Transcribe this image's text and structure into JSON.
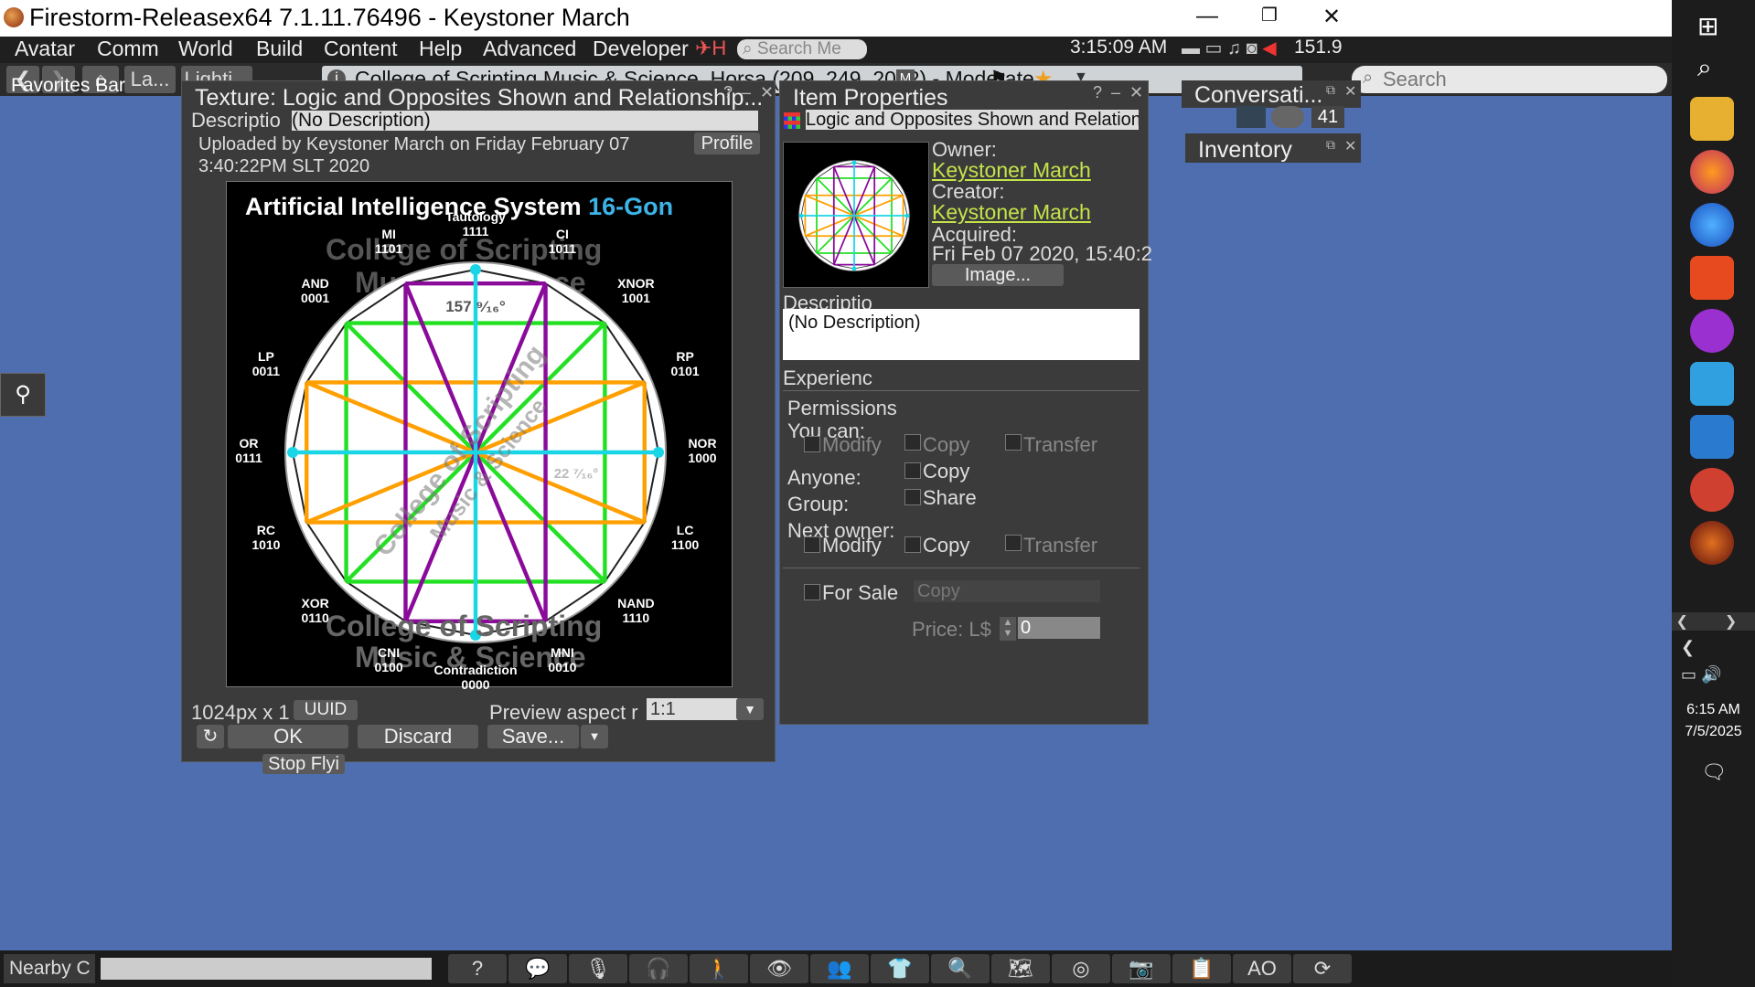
{
  "window": {
    "title": "Firestorm-Releasex64 7.1.11.76496 - Keystoner March"
  },
  "menu": {
    "items": [
      "Avatar",
      "Comm",
      "World",
      "Build",
      "Content",
      "Help",
      "Advanced",
      "Developer"
    ],
    "search_placeholder": "Search Me",
    "clock": "3:15:09 AM",
    "bandwidth": "151.9"
  },
  "nav": {
    "la": "La...",
    "lighting": "Lighti...",
    "location": "College of Scripting Music & Science, Horsa (209, 249, 2042) - Moderate",
    "rating_badge": "M",
    "search_placeholder": "Search"
  },
  "favorites": {
    "label": "Favorites Bar"
  },
  "texture": {
    "title": "Texture: Logic and Opposites Shown and Relationship...",
    "desc_label": "Descriptio",
    "desc_value": "(No Description)",
    "uploaded_line1": "Uploaded by Keystoner March on Friday February 07",
    "uploaded_line2": "3:40:22PM SLT 2020",
    "profile": "Profile",
    "image": {
      "heading": "Artificial Intelligence System",
      "heading_suffix": "16-Gon",
      "watermark_top1": "College of Scripting",
      "watermark_top2": "Music & Science",
      "watermark_bottom1": "College of Scripting",
      "watermark_bottom2": "Music & Science",
      "center_watermark1": "College of Scripting",
      "center_watermark2": "Music & Science",
      "angle_top": "157 ⁹⁄₁₆°",
      "angle_mid": "22 ⁷⁄₁₆°",
      "nodes": [
        {
          "name": "Tautology",
          "code": "1111"
        },
        {
          "name": "CI",
          "code": "1011"
        },
        {
          "name": "XNOR",
          "code": "1001"
        },
        {
          "name": "RP",
          "code": "0101"
        },
        {
          "name": "NOR",
          "code": "1000"
        },
        {
          "name": "LC",
          "code": "1100"
        },
        {
          "name": "NAND",
          "code": "1110"
        },
        {
          "name": "MNI",
          "code": "0010"
        },
        {
          "name": "Contradiction",
          "code": "0000"
        },
        {
          "name": "CNI",
          "code": "0100"
        },
        {
          "name": "XOR",
          "code": "0110"
        },
        {
          "name": "RC",
          "code": "1010"
        },
        {
          "name": "OR",
          "code": "0111"
        },
        {
          "name": "LP",
          "code": "0011"
        },
        {
          "name": "AND",
          "code": "0001"
        },
        {
          "name": "MI",
          "code": "1101"
        }
      ]
    },
    "size_label": "1024px x 1",
    "uuid": "UUID",
    "aspect_label": "Preview aspect r",
    "aspect_value": "1:1",
    "ok": "OK",
    "discard": "Discard",
    "save": "Save...",
    "stop_fly": "Stop Flyi"
  },
  "item": {
    "title": "Item Properties",
    "name": "Logic and Opposites Shown and Relation",
    "owner_label": "Owner:",
    "owner": "Keystoner March",
    "creator_label": "Creator:",
    "creator": "Keystoner March",
    "acquired_label": "Acquired:",
    "acquired": "Fri Feb 07 2020, 15:40:2",
    "image_btn": "Image...",
    "desc_label": "Descriptio",
    "desc_value": "(No Description)",
    "experience": "Experienc",
    "permissions": "Permissions",
    "you_can": "You can:",
    "modify": "Modify",
    "copy": "Copy",
    "transfer": "Transfer",
    "anyone": "Anyone:",
    "group": "Group:",
    "share": "Share",
    "next_owner": "Next owner:",
    "for_sale": "For Sale",
    "sale_type": "Copy",
    "price_label": "Price: L$",
    "price": "0"
  },
  "side": {
    "conversations": "Conversati...",
    "count": "41",
    "inventory": "Inventory"
  },
  "bottom": {
    "nearby": "Nearby C",
    "ao": "AO"
  },
  "taskbar": {
    "time": "6:15 AM",
    "date": "7/5/2025"
  },
  "colors": {
    "desktop": "#4f6eb0",
    "panel": "#3b3b3b",
    "link": "#c4e34a",
    "green": "#22e022",
    "orange": "#ff9f00",
    "purple": "#8a0a9a",
    "cyan": "#19d6e6"
  }
}
